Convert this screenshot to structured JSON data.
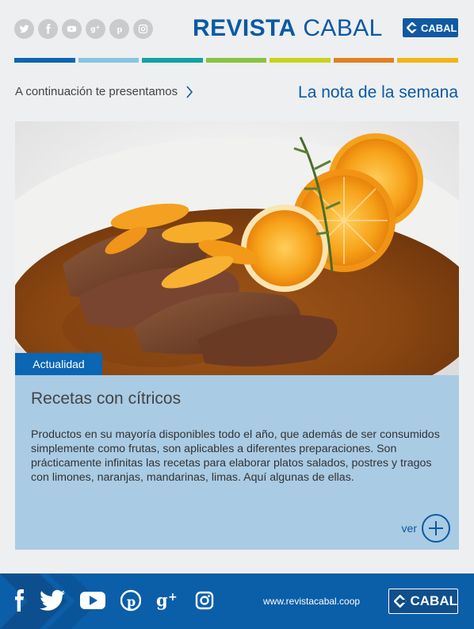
{
  "header": {
    "brand_bold": "REVISTA",
    "brand_light": "CABAL",
    "logo_text": "CABAL",
    "social_icons": [
      "twitter-icon",
      "facebook-icon",
      "youtube-icon",
      "googleplus-icon",
      "pinterest-icon",
      "instagram-icon"
    ],
    "strip_colors": [
      "#0b66b4",
      "#88c5e2",
      "#11a3a4",
      "#88c440",
      "#c7d41d",
      "#e37f20",
      "#f2b517"
    ]
  },
  "intro": {
    "text": "A continuación te presentamos",
    "section_title": "La nota de la semana"
  },
  "article": {
    "tag": "Actualidad",
    "title": "Recetas con cítricos",
    "body": "Productos en su mayoría disponibles todo el año, que además de ser consumidos simplemente como frutas, son aplicables a diferentes preparaciones. Son prácticamente infinitas las recetas para elaborar platos salados, postres y tragos con limones, naranjas, mandarinas, limas. Aquí algunas de ellas.",
    "more_label": "ver"
  },
  "footer": {
    "site": "www.revistacabal.coop",
    "logo_text": "CABAL",
    "social_icons": [
      "facebook-icon",
      "twitter-icon",
      "youtube-icon",
      "pinterest-icon",
      "googleplus-icon",
      "instagram-icon"
    ]
  },
  "colors": {
    "brand_blue": "#0a5aa3",
    "card_blue": "#a9cbe4",
    "footer_blue": "#0b5ea8"
  }
}
